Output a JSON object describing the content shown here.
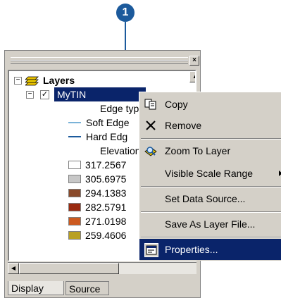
{
  "callout": {
    "number": "1"
  },
  "toc": {
    "layers_label": "Layers",
    "layer_name": "MyTIN",
    "legend": [
      {
        "label": "Edge typ",
        "kind": "heading"
      },
      {
        "label": "Soft Edge",
        "kind": "line",
        "color": "#7ab3d8"
      },
      {
        "label": "Hard Edg",
        "kind": "line",
        "color": "#1c5a9c"
      },
      {
        "label": "Elevation",
        "kind": "heading"
      },
      {
        "label": "317.2567",
        "kind": "swatch",
        "color": "#ffffff"
      },
      {
        "label": "305.6975",
        "kind": "swatch",
        "color": "#c7c7c7"
      },
      {
        "label": "294.1383",
        "kind": "swatch",
        "color": "#8a4a2a"
      },
      {
        "label": "282.5791",
        "kind": "swatch",
        "color": "#9a2a10"
      },
      {
        "label": "271.0198",
        "kind": "swatch",
        "color": "#cc5a20"
      },
      {
        "label": "259.4606",
        "kind": "swatch",
        "color": "#b8a022"
      }
    ],
    "tabs": {
      "display": "Display",
      "source": "Source"
    }
  },
  "menu": {
    "items": {
      "copy": "Copy",
      "remove": "Remove",
      "zoom": "Zoom To Layer",
      "visible_range": "Visible Scale Range",
      "set_source": "Set Data Source...",
      "save_layer": "Save As Layer File...",
      "properties": "Properties..."
    }
  },
  "colors": {
    "selection": "#0a246a",
    "callout": "#1c5a9c"
  }
}
